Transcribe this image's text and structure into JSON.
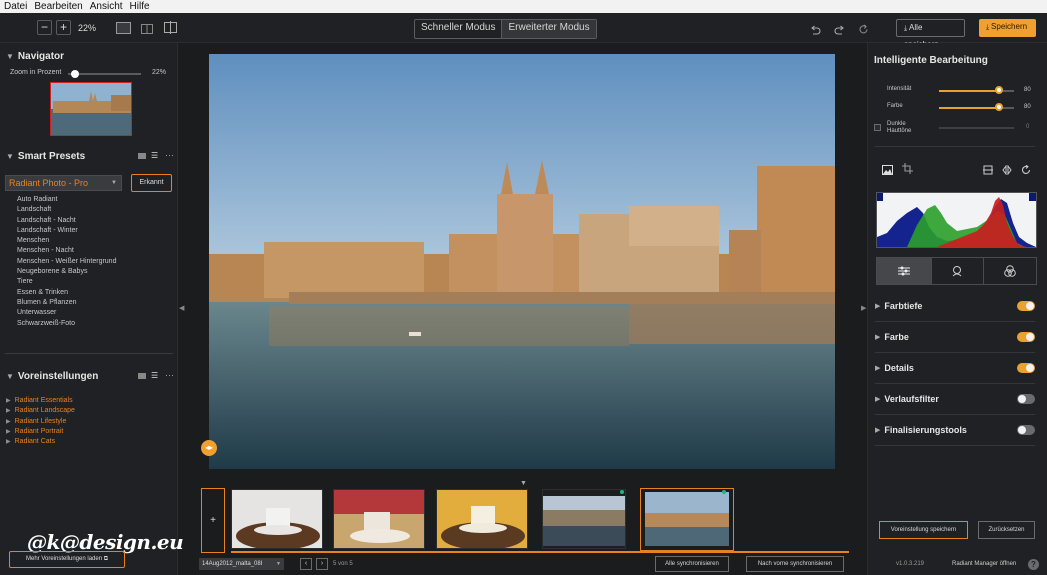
{
  "menu": [
    "Datei",
    "Bearbeiten",
    "Ansicht",
    "Hilfe"
  ],
  "toolbar": {
    "zoom_minus": "−",
    "zoom_plus": "+",
    "zoom_value": "22%",
    "mode_fast": "Schneller Modus",
    "mode_advanced": "Erweiterter Modus",
    "save_all": "Alle speichern",
    "save": "Speichern"
  },
  "navigator": {
    "title": "Navigator",
    "zoom_label": "Zoom in Prozent",
    "zoom_value": "22%",
    "zoom_level": 0.22
  },
  "smart_presets": {
    "title": "Smart Presets",
    "selected": "Radiant Photo - Pro",
    "detected": "Erkannt",
    "items": [
      "Auto Radiant",
      "Landschaft",
      "Landschaft - Nacht",
      "Landschaft - Winter",
      "Menschen",
      "Menschen - Nacht",
      "Menschen - Weißer Hintergrund",
      "Neugeborene & Babys",
      "Tiere",
      "Essen & Trinken",
      "Blumen & Pflanzen",
      "Unterwasser",
      "Schwarzweiß-Foto"
    ],
    "active_index": 1
  },
  "voreinstellungen": {
    "title": "Voreinstellungen",
    "items": [
      "Radiant Essentials",
      "Radiant Landscape",
      "Radiant Lifestyle",
      "Radiant Portrait",
      "Radiant Cats"
    ],
    "load_more": "Mehr Voreinstellungen laden"
  },
  "watermark": "@k@design.eu",
  "intelligent": {
    "title": "Intelligente Bearbeitung",
    "sliders": [
      {
        "label": "Intensität",
        "value": "80",
        "level": 0.8
      },
      {
        "label": "Farbe",
        "value": "80",
        "level": 0.8
      },
      {
        "label": "Dunkle Hauttöne",
        "value": "0",
        "level": 0
      }
    ]
  },
  "sections": [
    {
      "label": "Farbtiefe",
      "enabled": true
    },
    {
      "label": "Farbe",
      "enabled": true
    },
    {
      "label": "Details",
      "enabled": true
    },
    {
      "label": "Verlaufsfilter",
      "enabled": false
    },
    {
      "label": "Finalisierungstools",
      "enabled": false
    }
  ],
  "right_buttons": {
    "save_preset": "Voreinstellung speichern",
    "reset": "Zurücksetzen"
  },
  "footer": {
    "version": "v1.0.3.219",
    "manager": "Radiant Manager öffnen",
    "filename": "14Aug2012_malta_08I",
    "page_counter": "5 von 5",
    "sync_all": "Alle synchronisieren",
    "sync_forward": "Nach vorne synchronisieren"
  },
  "colors": {
    "accent": "#e8821e",
    "save_button": "#f0a030",
    "toggle_on": "#e8a22e",
    "toggle_off": "#6a6b6e"
  }
}
